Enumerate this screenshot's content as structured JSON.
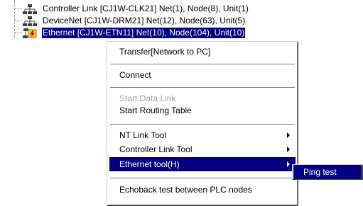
{
  "tree": {
    "items": [
      {
        "label": "Controller Link [CJ1W-CLK21] Net(1), Node(8), Unit(1)",
        "icon": "network-node-icon"
      },
      {
        "label": "DeviceNet [CJ1W-DRM21] Net(12), Node(63), Unit(5)",
        "icon": "network-node-icon"
      },
      {
        "label": "Ethernet [CJ1W-ETN11] Net(10), Node(104), Unit(10)",
        "icon": "ethernet-node-icon"
      }
    ]
  },
  "context_menu": {
    "transfer": "Transfer[Network to PC]",
    "connect": "Connect",
    "start_data_link": "Start Data Link",
    "start_routing_table": "Start Routing Table",
    "nt_link_tool": "NT Link Tool",
    "controller_link_tool": "Controller Link Tool",
    "ethernet_tool": "Ethernet tool(H)",
    "echoback_test": "Echoback test between PLC nodes"
  },
  "submenu": {
    "ping_test": "Ping test"
  },
  "colors": {
    "highlight": "#000080",
    "disabled_text": "#a0a0a0",
    "focus_outline": "#ffff00"
  }
}
